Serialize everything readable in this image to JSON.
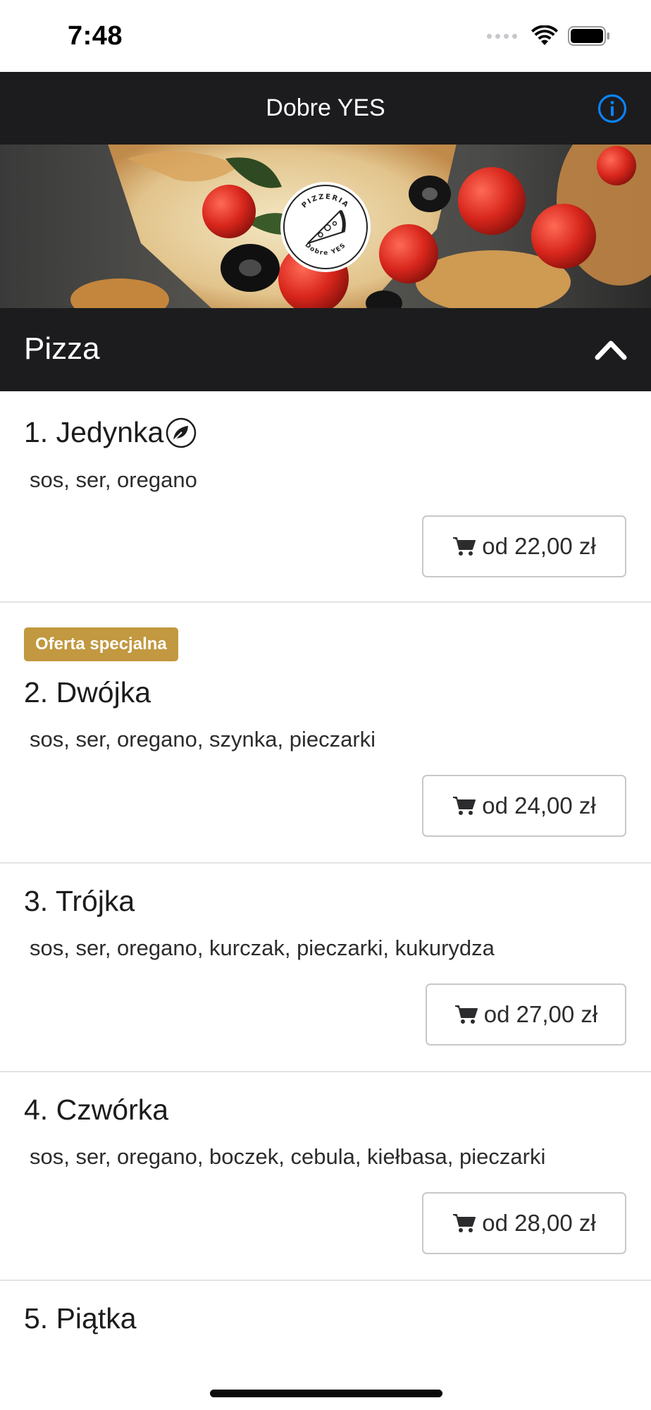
{
  "status_bar": {
    "time": "7:48",
    "icons": [
      "signal-dots-icon",
      "wifi-icon",
      "battery-icon"
    ]
  },
  "nav": {
    "title": "Dobre YES",
    "info_icon": "info-circle-icon",
    "accent_color": "#0a84ff"
  },
  "banner": {
    "logo_top_text": "PIZZERIA",
    "logo_bottom_text": "Dobre YES"
  },
  "category": {
    "title": "Pizza",
    "expanded_icon": "chevron-up-icon"
  },
  "items": [
    {
      "name": "1. Jedynka",
      "vegetarian": true,
      "description": "sos, ser, oregano",
      "price": "od 22,00 zł"
    },
    {
      "badge": "Oferta specjalna",
      "name": "2. Dwójka",
      "description": "sos, ser, oregano, szynka, pieczarki",
      "price": "od 24,00 zł"
    },
    {
      "name": "3. Trójka",
      "description": "sos, ser, oregano, kurczak, pieczarki, kukurydza",
      "price": "od 27,00 zł"
    },
    {
      "name": "4. Czwórka",
      "description": "sos, ser, oregano, boczek, cebula, kiełbasa, pieczarki",
      "price": "od 28,00 zł"
    },
    {
      "name": "5. Piątka"
    }
  ],
  "colors": {
    "header_bg": "#1c1c1e",
    "badge_bg": "#c29840"
  }
}
